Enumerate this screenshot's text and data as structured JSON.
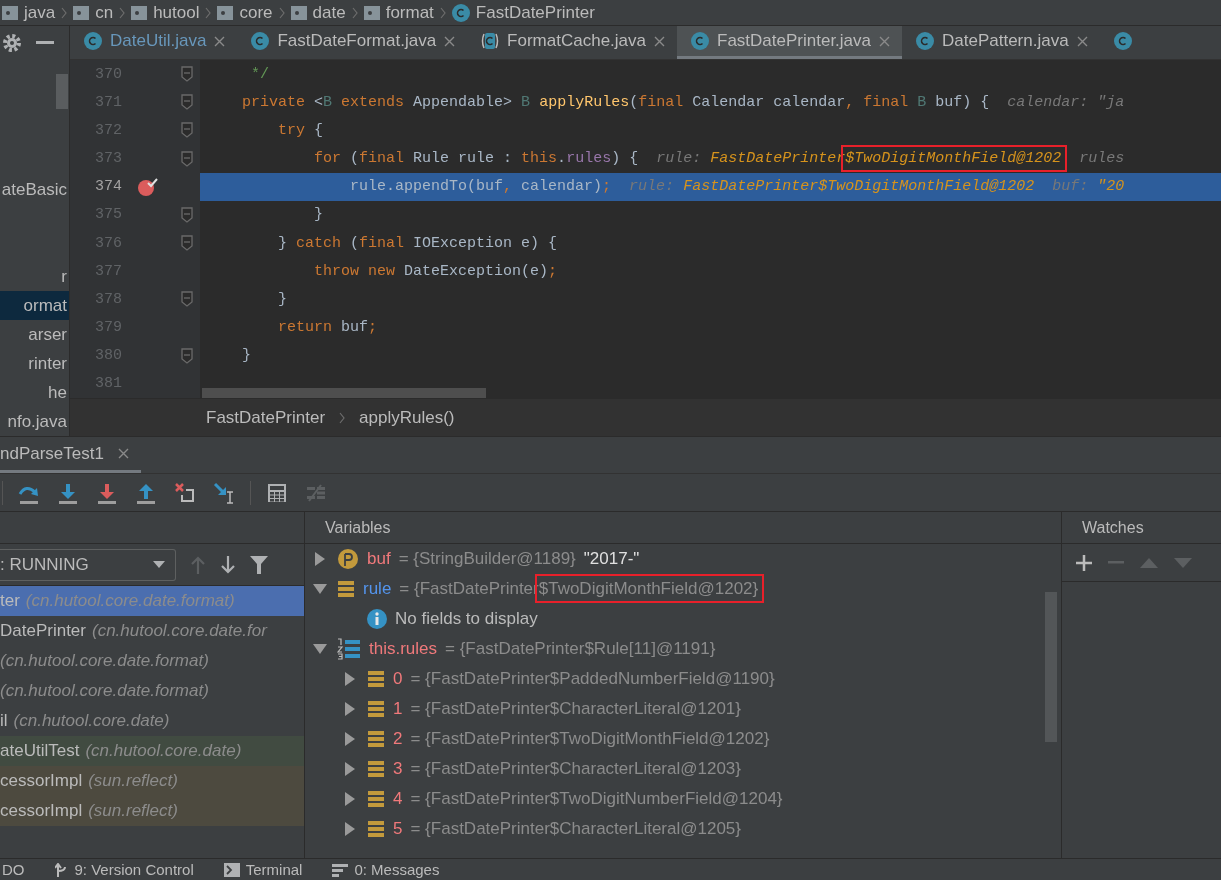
{
  "nav_path": [
    {
      "label": "java",
      "kind": "package"
    },
    {
      "label": "cn",
      "kind": "package"
    },
    {
      "label": "hutool",
      "kind": "package"
    },
    {
      "label": "core",
      "kind": "package"
    },
    {
      "label": "date",
      "kind": "package"
    },
    {
      "label": "format",
      "kind": "package"
    },
    {
      "label": "FastDatePrinter",
      "kind": "class"
    }
  ],
  "project_panel": {
    "items": [
      {
        "label": "ateBasic",
        "selected": false
      },
      {
        "label": "r",
        "selected": false
      },
      {
        "label": "ormat",
        "selected": true
      },
      {
        "label": "arser",
        "selected": false
      },
      {
        "label": "rinter",
        "selected": false
      },
      {
        "label": "he",
        "selected": false
      },
      {
        "label": "nfo.java",
        "selected": false
      }
    ]
  },
  "editor_tabs": [
    {
      "label": "DateUtil.java",
      "kind": "class",
      "selected": false,
      "modified": true
    },
    {
      "label": "FastDateFormat.java",
      "kind": "class",
      "selected": false,
      "modified": false
    },
    {
      "label": "FormatCache.java",
      "kind": "abstract",
      "selected": false,
      "modified": false
    },
    {
      "label": "FastDatePrinter.java",
      "kind": "class",
      "selected": true,
      "modified": false
    },
    {
      "label": "DatePattern.java",
      "kind": "class",
      "selected": false,
      "modified": false
    },
    {
      "kind": "class",
      "selected": false
    }
  ],
  "code_lines": [
    {
      "number": "370",
      "fold": true,
      "breakpoint": false,
      "current": false,
      "tokens": [
        {
          "text": "     */",
          "kind": "comment"
        }
      ]
    },
    {
      "number": "371",
      "fold": true,
      "breakpoint": false,
      "current": false,
      "tokens": [
        {
          "text": "    private",
          "kind": "kw"
        },
        {
          "text": " <",
          "kind": "plain"
        },
        {
          "text": "B",
          "kind": "tparam"
        },
        {
          "text": " extends",
          "kind": "kw"
        },
        {
          "text": " Appendable> ",
          "kind": "plain"
        },
        {
          "text": "B",
          "kind": "tparam"
        },
        {
          "text": " applyRules",
          "kind": "method"
        },
        {
          "text": "(",
          "kind": "plain"
        },
        {
          "text": "final",
          "kind": "kw"
        },
        {
          "text": " Calendar calendar",
          "kind": "plain"
        },
        {
          "text": ",",
          "kind": "kw"
        },
        {
          "text": " final",
          "kind": "kw"
        },
        {
          "text": " B",
          "kind": "tparam"
        },
        {
          "text": " buf) {",
          "kind": "plain"
        }
      ],
      "hints": [
        {
          "label": "calendar: ",
          "kind": "muted",
          "value": [
            {
              "text": "\"ja",
              "boxed": false
            }
          ]
        }
      ]
    },
    {
      "number": "372",
      "fold": true,
      "breakpoint": false,
      "current": false,
      "tokens": [
        {
          "text": "        try",
          "kind": "kw"
        },
        {
          "text": " {",
          "kind": "plain"
        }
      ]
    },
    {
      "number": "373",
      "fold": true,
      "breakpoint": false,
      "current": false,
      "tokens": [
        {
          "text": "            for",
          "kind": "kw"
        },
        {
          "text": " (",
          "kind": "plain"
        },
        {
          "text": "final",
          "kind": "kw"
        },
        {
          "text": " Rule rule : ",
          "kind": "plain"
        },
        {
          "text": "this",
          "kind": "kw"
        },
        {
          "text": ".",
          "kind": "plain"
        },
        {
          "text": "rules",
          "kind": "field"
        },
        {
          "text": ") {",
          "kind": "plain"
        }
      ],
      "hints": [
        {
          "label": "rule: ",
          "kind": "accent",
          "value": [
            {
              "text": "FastDatePrinter",
              "boxed": false
            },
            {
              "text": "$TwoDigitMonthField@1202",
              "boxed": true
            }
          ]
        },
        {
          "label": "rules",
          "kind": "muted"
        }
      ]
    },
    {
      "number": "374",
      "fold": false,
      "breakpoint": true,
      "current": true,
      "tokens": [
        {
          "text": "                rule.appendTo(buf",
          "kind": "plain"
        },
        {
          "text": ",",
          "kind": "kw"
        },
        {
          "text": " calendar)",
          "kind": "plain"
        },
        {
          "text": ";",
          "kind": "kw"
        }
      ],
      "hints": [
        {
          "label": "rule: ",
          "kind": "accent",
          "value": [
            {
              "text": "FastDatePrinter$TwoDigitMonthField@1202",
              "boxed": false
            }
          ]
        },
        {
          "label": "buf: ",
          "kind": "accent",
          "value": [
            {
              "text": "\"20",
              "boxed": false
            }
          ]
        }
      ]
    },
    {
      "number": "375",
      "fold": true,
      "breakpoint": false,
      "current": false,
      "tokens": [
        {
          "text": "            }",
          "kind": "plain"
        }
      ]
    },
    {
      "number": "376",
      "fold": true,
      "breakpoint": false,
      "current": false,
      "tokens": [
        {
          "text": "        } ",
          "kind": "plain"
        },
        {
          "text": "catch",
          "kind": "kw"
        },
        {
          "text": " (",
          "kind": "plain"
        },
        {
          "text": "final",
          "kind": "kw"
        },
        {
          "text": " IOException e) {",
          "kind": "plain"
        }
      ]
    },
    {
      "number": "377",
      "fold": false,
      "breakpoint": false,
      "current": false,
      "tokens": [
        {
          "text": "            throw new",
          "kind": "kw"
        },
        {
          "text": " DateException(e)",
          "kind": "plain"
        },
        {
          "text": ";",
          "kind": "kw"
        }
      ]
    },
    {
      "number": "378",
      "fold": true,
      "breakpoint": false,
      "current": false,
      "tokens": [
        {
          "text": "        }",
          "kind": "plain"
        }
      ]
    },
    {
      "number": "379",
      "fold": false,
      "breakpoint": false,
      "current": false,
      "tokens": [
        {
          "text": "        return",
          "kind": "kw"
        },
        {
          "text": " buf",
          "kind": "plain"
        },
        {
          "text": ";",
          "kind": "kw"
        }
      ]
    },
    {
      "number": "380",
      "fold": true,
      "breakpoint": false,
      "current": false,
      "tokens": [
        {
          "text": "    }",
          "kind": "plain"
        }
      ]
    },
    {
      "number": "381",
      "fold": false,
      "breakpoint": false,
      "current": false
    }
  ],
  "editor_path": [
    "FastDatePrinter",
    "applyRules()"
  ],
  "debug_tab": {
    "label": "ndParseTest1",
    "selected": true
  },
  "debug_toolbar": [
    {
      "kind": "step-over",
      "disabled": false
    },
    {
      "kind": "step-into",
      "disabled": false
    },
    {
      "kind": "force-step-into",
      "disabled": false
    },
    {
      "kind": "step-out",
      "disabled": false
    },
    {
      "kind": "drop-frame",
      "disabled": false
    },
    {
      "kind": "run-to-cursor",
      "disabled": false
    },
    {
      "kind": "evaluate",
      "disabled": false
    },
    {
      "kind": "trace",
      "disabled": true
    }
  ],
  "frames": {
    "thread": ": RUNNING",
    "items": [
      {
        "method": "ter",
        "package": "(cn.hutool.core.date.format)",
        "selected": true
      },
      {
        "method": "DatePrinter",
        "package": "(cn.hutool.core.date.for",
        "selected": false,
        "kind": "normal"
      },
      {
        "package": "(cn.hutool.core.date.format)",
        "selected": false,
        "kind": "normal"
      },
      {
        "package": "(cn.hutool.core.date.format)",
        "selected": false,
        "kind": "normal"
      },
      {
        "method": "il",
        "package": "(cn.hutool.core.date)",
        "selected": false,
        "kind": "normal"
      },
      {
        "method": "ateUtilTest",
        "package": "(cn.hutool.core.date)",
        "selected": false,
        "kind": "test"
      },
      {
        "method": "cessorImpl",
        "package": "(sun.reflect)",
        "selected": false,
        "kind": "library"
      },
      {
        "method": "cessorImpl",
        "package": "(sun.reflect)",
        "selected": false,
        "kind": "library"
      }
    ]
  },
  "variables": {
    "title": "Variables",
    "items": [
      {
        "kind": "param",
        "name": "buf",
        "changed": false,
        "expanded": false,
        "value": [
          {
            "text": "= {StringBuilder@1189}",
            "boxed": false
          }
        ],
        "string": "\"2017-\""
      },
      {
        "kind": "field",
        "name": "rule",
        "changed": true,
        "expanded": true,
        "value": [
          {
            "text": "= {FastDatePrinter",
            "boxed": false
          },
          {
            "text": "$TwoDigitMonthField@1202}",
            "boxed": true
          }
        ],
        "children": [
          {
            "kind": "info",
            "name": "No fields to display"
          }
        ]
      },
      {
        "kind": "array",
        "name": "this.rules",
        "changed": false,
        "expanded": true,
        "value": [
          {
            "text": "= {FastDatePrinter$Rule[11]@1191}",
            "boxed": false
          }
        ],
        "children": [
          {
            "kind": "field",
            "name": "0",
            "changed": false,
            "expanded": false,
            "value": [
              {
                "text": "= {FastDatePrinter$PaddedNumberField@1190}",
                "boxed": false
              }
            ]
          },
          {
            "kind": "field",
            "name": "1",
            "changed": false,
            "expanded": false,
            "value": [
              {
                "text": "= {FastDatePrinter$CharacterLiteral@1201}",
                "boxed": false
              }
            ]
          },
          {
            "kind": "field",
            "name": "2",
            "changed": false,
            "expanded": false,
            "value": [
              {
                "text": "= {FastDatePrinter$TwoDigitMonthField@1202}",
                "boxed": false
              }
            ]
          },
          {
            "kind": "field",
            "name": "3",
            "changed": false,
            "expanded": false,
            "value": [
              {
                "text": "= {FastDatePrinter$CharacterLiteral@1203}",
                "boxed": false
              }
            ]
          },
          {
            "kind": "field",
            "name": "4",
            "changed": false,
            "expanded": false,
            "value": [
              {
                "text": "= {FastDatePrinter$TwoDigitNumberField@1204}",
                "boxed": false
              }
            ]
          },
          {
            "kind": "field",
            "name": "5",
            "changed": false,
            "expanded": false,
            "value": [
              {
                "text": "= {FastDatePrinter$CharacterLiteral@1205}",
                "boxed": false
              }
            ]
          }
        ]
      }
    ]
  },
  "watches": {
    "title": "Watches"
  },
  "status_bar": [
    {
      "label": "DO",
      "kind": "none"
    },
    {
      "label": "9: Version Control",
      "kind": "vcs"
    },
    {
      "label": "Terminal",
      "kind": "terminal"
    },
    {
      "label": "0: Messages",
      "kind": "messages"
    }
  ]
}
